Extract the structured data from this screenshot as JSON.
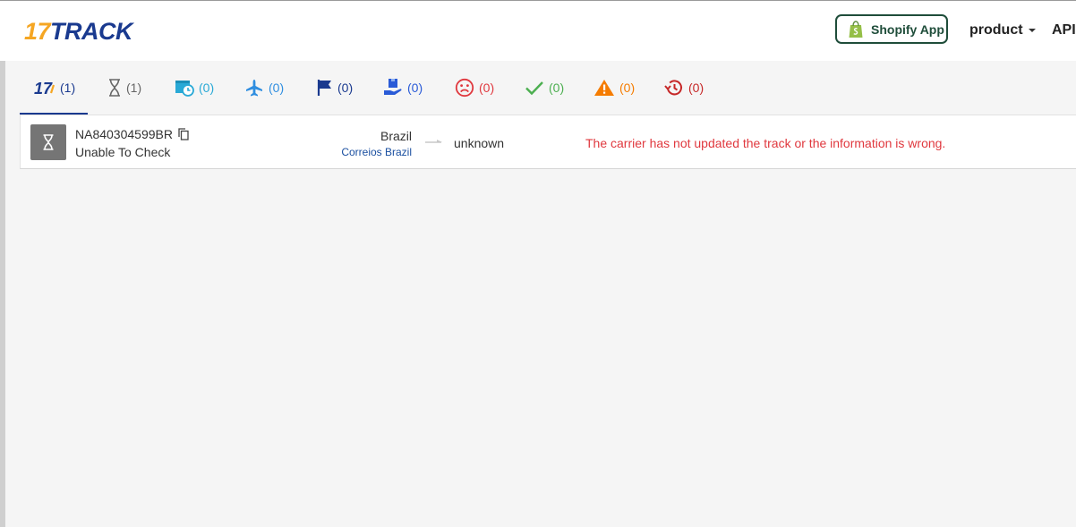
{
  "header": {
    "logo": {
      "num": "17",
      "word": "TRACK"
    },
    "shopify_button": "Shopify App",
    "nav": {
      "product": "product",
      "api": "API"
    }
  },
  "colors": {
    "brand_blue": "#1a3a8f",
    "brand_orange": "#f5a623",
    "error_red": "#e0383e",
    "shopify_green": "#1f4d3a"
  },
  "tabs": [
    {
      "icon": "17track-all-icon",
      "count": "(1)",
      "color": "#1a3a8f"
    },
    {
      "icon": "hourglass-icon",
      "count": "(1)",
      "color": "#666666"
    },
    {
      "icon": "package-clock-icon",
      "count": "(0)",
      "color": "#29a9d6"
    },
    {
      "icon": "airplane-icon",
      "count": "(0)",
      "color": "#2f8ee0"
    },
    {
      "icon": "flag-icon",
      "count": "(0)",
      "color": "#1a3a8f"
    },
    {
      "icon": "pickup-hand-icon",
      "count": "(0)",
      "color": "#2a5bd7"
    },
    {
      "icon": "sad-face-icon",
      "count": "(0)",
      "color": "#e0383e"
    },
    {
      "icon": "checkmark-icon",
      "count": "(0)",
      "color": "#4caf50"
    },
    {
      "icon": "warning-icon",
      "count": "(0)",
      "color": "#f57c00"
    },
    {
      "icon": "history-icon",
      "count": "(0)",
      "color": "#c62828"
    }
  ],
  "shipment": {
    "status_icon": "hourglass-icon",
    "tracking_number": "NA840304599BR",
    "status": "Unable To Check",
    "origin_country": "Brazil",
    "carrier": "Correios Brazil",
    "destination": "unknown",
    "message": "The carrier has not updated the track or the information is wrong."
  }
}
